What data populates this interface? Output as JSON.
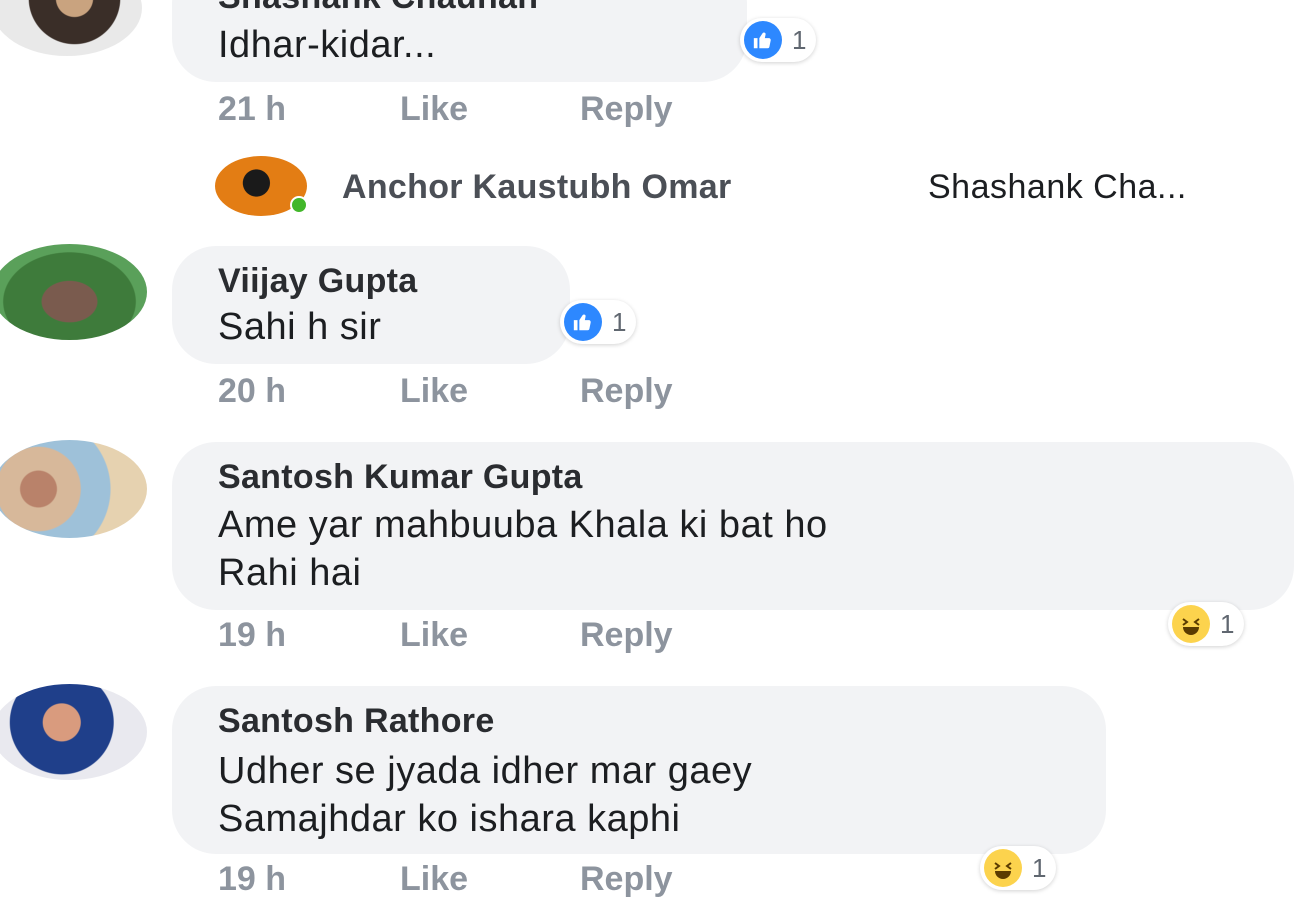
{
  "comments": [
    {
      "name": "Shashank Chauhan",
      "text": "Idhar-kidar...",
      "time": "21 h",
      "like": "Like",
      "reply": "Reply",
      "reaction": {
        "type": "like",
        "count": "1"
      }
    },
    {
      "name": "Viijay Gupta",
      "text": "Sahi h sir",
      "time": "20 h",
      "like": "Like",
      "reply": "Reply",
      "reaction": {
        "type": "like",
        "count": "1"
      }
    },
    {
      "name": "Santosh Kumar Gupta",
      "text_lines": [
        "Ame yar  mahbuuba Khala ki bat ho",
        "Rahi hai"
      ],
      "time": "19 h",
      "like": "Like",
      "reply": "Reply",
      "reaction": {
        "type": "haha",
        "count": "1"
      }
    },
    {
      "name": "Santosh Rathore",
      "text_lines": [
        "Udher se jyada idher mar gaey",
        "Samajhdar ko ishara kaphi"
      ],
      "time": "19 h",
      "like": "Like",
      "reply": "Reply",
      "reaction": {
        "type": "haha",
        "count": "1"
      }
    }
  ],
  "reply_preview": {
    "name": "Anchor Kaustubh Omar",
    "text": "Shashank Cha..."
  },
  "colors": {
    "bubble": "#f2f3f5",
    "like_blue": "#2d88ff",
    "haha_yellow": "#fcd34d",
    "meta_gray": "#8d949e"
  }
}
